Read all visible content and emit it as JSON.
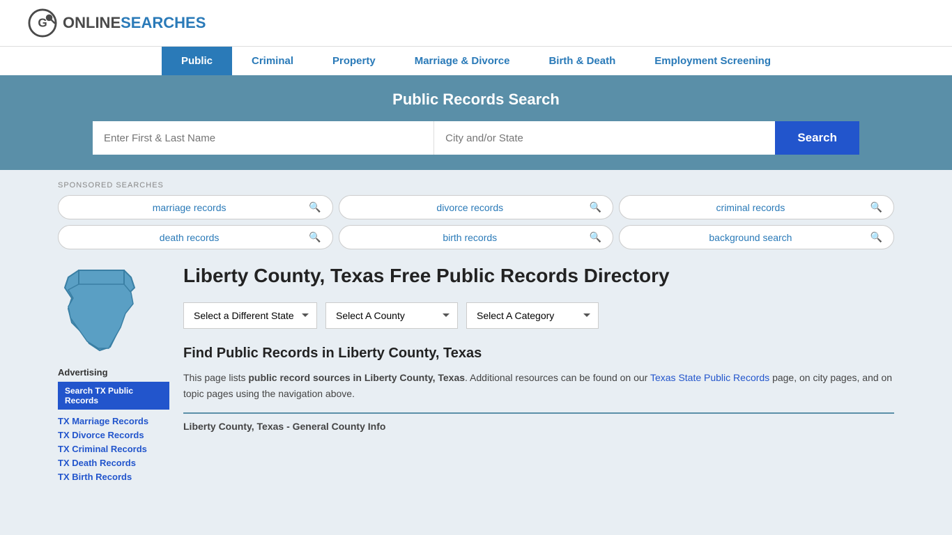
{
  "logo": {
    "online": "ONLINE",
    "searches": "SEARCHES"
  },
  "nav": {
    "items": [
      {
        "label": "Public",
        "active": true
      },
      {
        "label": "Criminal",
        "active": false
      },
      {
        "label": "Property",
        "active": false
      },
      {
        "label": "Marriage & Divorce",
        "active": false
      },
      {
        "label": "Birth & Death",
        "active": false
      },
      {
        "label": "Employment Screening",
        "active": false
      }
    ]
  },
  "hero": {
    "title": "Public Records Search",
    "name_placeholder": "Enter First & Last Name",
    "location_placeholder": "City and/or State",
    "search_button": "Search"
  },
  "sponsored": {
    "label": "SPONSORED SEARCHES",
    "items": [
      {
        "text": "marriage records"
      },
      {
        "text": "divorce records"
      },
      {
        "text": "criminal records"
      },
      {
        "text": "death records"
      },
      {
        "text": "birth records"
      },
      {
        "text": "background search"
      }
    ]
  },
  "sidebar": {
    "advertising_label": "Advertising",
    "featured_link": "Search TX Public Records",
    "links": [
      "TX Marriage Records",
      "TX Divorce Records",
      "TX Criminal Records",
      "TX Death Records",
      "TX Birth Records"
    ]
  },
  "main": {
    "page_title": "Liberty County, Texas Free Public Records Directory",
    "dropdowns": {
      "state": "Select a Different State",
      "county": "Select A County",
      "category": "Select A Category"
    },
    "find_title": "Find Public Records in Liberty County, Texas",
    "find_description_1": "This page lists ",
    "find_description_bold": "public record sources in Liberty County, Texas",
    "find_description_2": ". Additional resources can be found on our ",
    "find_link_text": "Texas State Public Records",
    "find_description_3": " page, on city pages, and on topic pages using the navigation above.",
    "county_info_title": "Liberty County, Texas - General County Info"
  },
  "colors": {
    "blue_nav": "#2a7ab8",
    "blue_hero": "#5a8fa8",
    "blue_btn": "#2255cc"
  }
}
